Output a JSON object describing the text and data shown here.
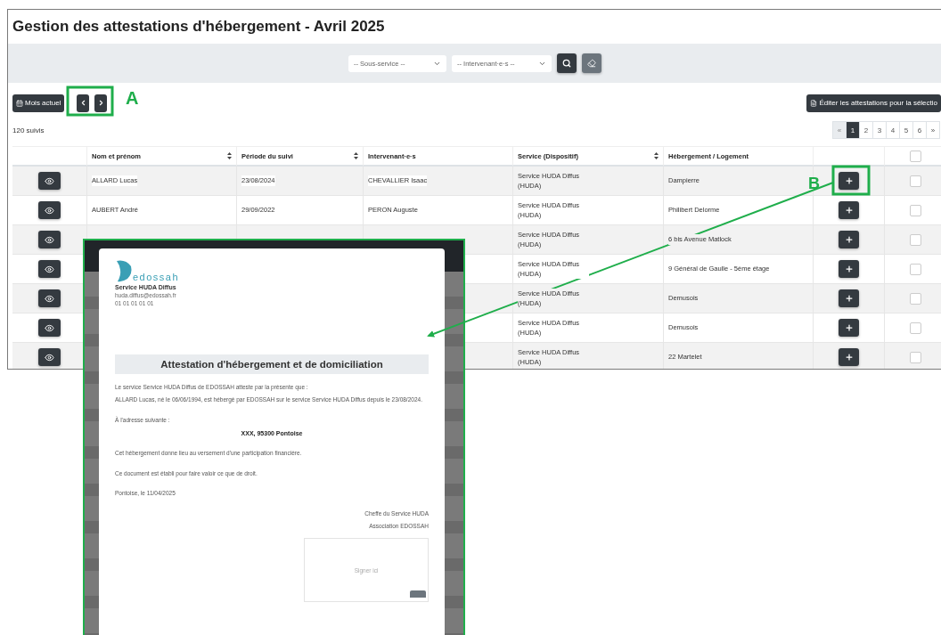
{
  "title": "Gestion des attestations d'hébergement - Avril 2025",
  "filters": [
    {
      "value": "-- Sous-service --"
    },
    {
      "value": "-- Intervenant·e·s --"
    }
  ],
  "toolbar": {
    "current_month": "Mois actuel",
    "bulk_edit": "Éditer les attestations pour la sélectio"
  },
  "count": "120 suivis",
  "pagination": [
    {
      "label": "«",
      "selected": false,
      "disabled": true
    },
    {
      "label": "1",
      "selected": true,
      "disabled": false
    },
    {
      "label": "2",
      "selected": false,
      "disabled": false
    },
    {
      "label": "3",
      "selected": false,
      "disabled": false
    },
    {
      "label": "4",
      "selected": false,
      "disabled": false
    },
    {
      "label": "5",
      "selected": false,
      "disabled": false
    },
    {
      "label": "6",
      "selected": false,
      "disabled": false
    },
    {
      "label": "»",
      "selected": false,
      "disabled": false
    }
  ],
  "table": {
    "columns": [
      {
        "label": "Nom et prénom",
        "sortable": true
      },
      {
        "label": "Période du suivi",
        "sortable": true
      },
      {
        "label": "Intervenant·e·s",
        "sortable": false
      },
      {
        "label": "Service (Dispositif)",
        "sortable": true
      },
      {
        "label": "Hébergement / Logement",
        "sortable": false
      }
    ],
    "select_all": {
      "checked": false
    },
    "rows": [
      {
        "name": "ALLARD Lucas",
        "period": "23/08/2024",
        "intervenant": "CHEVALLIER Isaac",
        "service": "Service HUDA Diffus (HUDA)",
        "housing": "Dampierre",
        "checked": false
      },
      {
        "name": "AUBERT André",
        "period": "29/09/2022",
        "intervenant": "PERON Auguste",
        "service": "Service HUDA Diffus (HUDA)",
        "housing": "Philibert Delorme",
        "checked": false
      },
      {
        "service": "Service HUDA Diffus (HUDA)",
        "housing": "6 bis Avenue Matlock",
        "checked": false
      },
      {
        "service": "Service HUDA Diffus (HUDA)",
        "housing": "9 Général de Gaulle - 5ème étage",
        "checked": false
      },
      {
        "service": "Service HUDA Diffus (HUDA)",
        "housing": "Demusois",
        "checked": false
      },
      {
        "service": "Service HUDA Diffus (HUDA)",
        "housing": "Demusois",
        "checked": false
      },
      {
        "service": "Service HUDA Diffus (HUDA)",
        "housing": "22 Martelet",
        "checked": false
      }
    ]
  },
  "document": {
    "logo_text": "edossah",
    "service": "Service HUDA Diffus",
    "email": "huda.diffus@edossah.fr",
    "phone": "01 01 01 01 01",
    "title": "Attestation d'hébergement et de domiciliation",
    "body": [
      [
        {
          "kind": "text",
          "text": "Le service Service HUDA Diffus de EDOSSAH atteste par la présente que :"
        },
        {
          "kind": "text",
          "text": "ALLARD Lucas, né le 06/06/1994, est hébergé par EDOSSAH sur le service Service HUDA Diffus depuis le 23/08/2024."
        }
      ],
      [
        {
          "kind": "text",
          "text": "À l'adresse suivante :"
        },
        {
          "kind": "address",
          "text": "XXX, 95300 Pontoise"
        }
      ],
      [
        {
          "kind": "text",
          "text": "Cet hébergement donne lieu au versement d'une participation financière."
        }
      ],
      [
        {
          "kind": "text",
          "text": "Ce document est établi pour faire valoir ce que de droit."
        }
      ],
      [
        {
          "kind": "date",
          "text": "Pontoise, le 11/04/2025"
        }
      ],
      [
        {
          "kind": "signer",
          "text": "Cheffe du Service HUDA"
        },
        {
          "kind": "signer",
          "text": "Association EDOSSAH"
        }
      ]
    ],
    "signature": {
      "placeholder": "Signer ici"
    }
  },
  "annotations": [
    {
      "label": "A"
    },
    {
      "label": "B"
    }
  ]
}
